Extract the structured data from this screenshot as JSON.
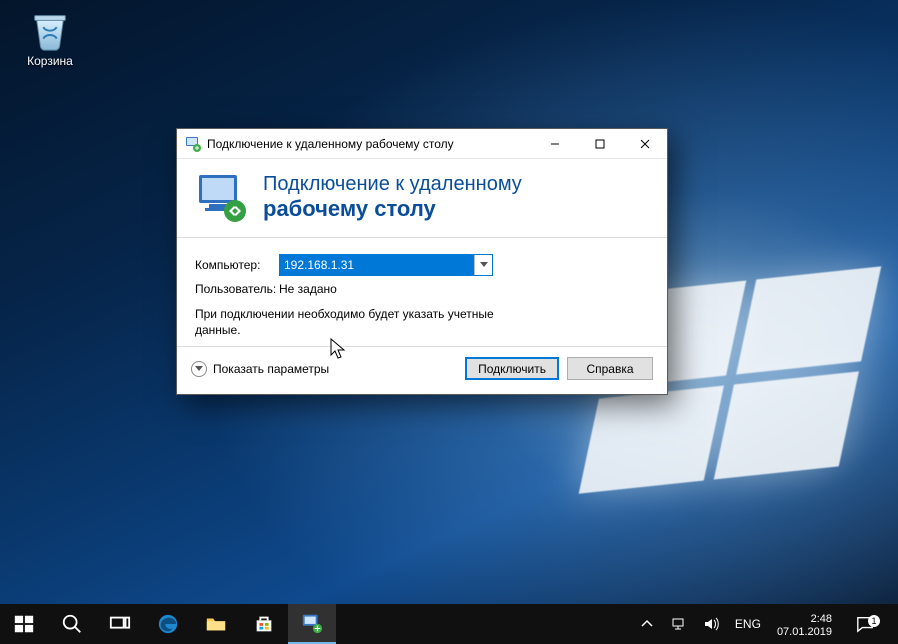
{
  "desktop": {
    "icons": {
      "recycle_bin": "Корзина"
    }
  },
  "rdp": {
    "window_title": "Подключение к удаленному рабочему столу",
    "heading_line1": "Подключение к удаленному",
    "heading_line2": "рабочему столу",
    "labels": {
      "computer": "Компьютер:",
      "user": "Пользователь:"
    },
    "values": {
      "computer": "192.168.1.31",
      "user": "Не задано"
    },
    "info_text": "При подключении необходимо будет указать учетные данные.",
    "show_options": "Показать параметры",
    "buttons": {
      "connect": "Подключить",
      "help": "Справка"
    }
  },
  "taskbar": {
    "lang": "ENG",
    "time": "2:48",
    "date": "07.01.2019",
    "notif_count": "1"
  }
}
